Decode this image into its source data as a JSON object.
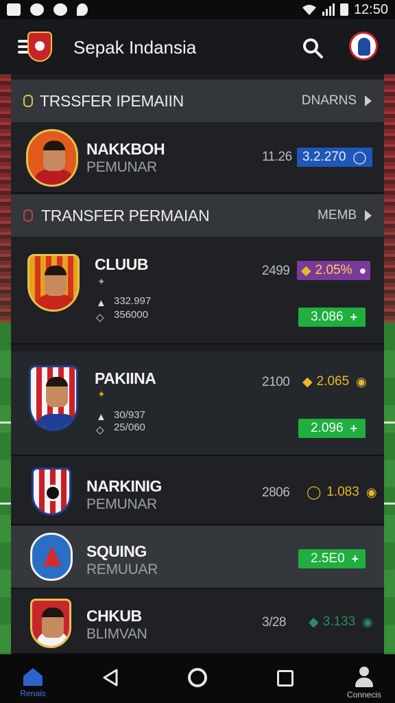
{
  "status_bar": {
    "time": "12:50"
  },
  "app_bar": {
    "title": "Sepak Indansia"
  },
  "sections": [
    {
      "title": "TRSSFER IPEMAIIN",
      "more_label": "DNARNS"
    },
    {
      "title": "TRANSFER PERMAIAN",
      "more_label": "MEMB"
    }
  ],
  "cards": [
    {
      "name": "NAKKBOH",
      "subtitle": "PEMUNAR",
      "number": "11.26",
      "value": "3.2.270",
      "value_color": "blue",
      "value_icon": "shield-icon"
    },
    {
      "name": "CLUUB",
      "subtitle": "",
      "number": "2499",
      "value": "2.05%",
      "value_color": "purple",
      "value_icon": "ball-icon",
      "stats": [
        "332.997",
        "356000"
      ],
      "action_value": "3.086",
      "action_icon": "+"
    },
    {
      "name": "PAKIINA",
      "subtitle": "",
      "number": "2100",
      "value": "2.065",
      "value_color": "gold",
      "value_icon": "ball-icon",
      "stats": [
        "30/937",
        "25/060"
      ],
      "action_value": "2.096",
      "action_icon": "+"
    },
    {
      "name": "NARKINIG",
      "subtitle": "PEMUNAR",
      "number": "2806",
      "value": "1.083",
      "value_color": "gold",
      "value_icon": "ball-icon"
    },
    {
      "name": "SQUING",
      "subtitle": "REMUUAR",
      "action_value": "2.5E0",
      "action_icon": "+"
    },
    {
      "name": "CHKUB",
      "subtitle": "BLIMVAN",
      "number": "3/28",
      "value": "3.133",
      "value_color": "teal",
      "value_icon": "ball-icon"
    }
  ],
  "bottom_nav": {
    "home_label": "Renais",
    "account_label": "Connecis"
  },
  "colors": {
    "accent_blue": "#1f57b8",
    "accent_green": "#1fae3f",
    "accent_purple": "#7a3a9a",
    "gold": "#e8b82a"
  }
}
